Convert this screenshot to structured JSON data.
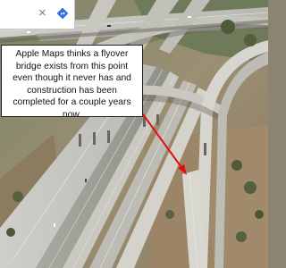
{
  "search": {
    "text": "",
    "close_glyph": "×",
    "directions_icon": "directions-icon"
  },
  "annotation": {
    "text": "Apple Maps thinks a flyover bridge exists from this point even though it never has and construction has been completed for a couple years now."
  },
  "colors": {
    "arrow": "#e01010",
    "box_background": "#ffffff",
    "box_border": "#222222",
    "directions_blue": "#2f6fe0"
  }
}
